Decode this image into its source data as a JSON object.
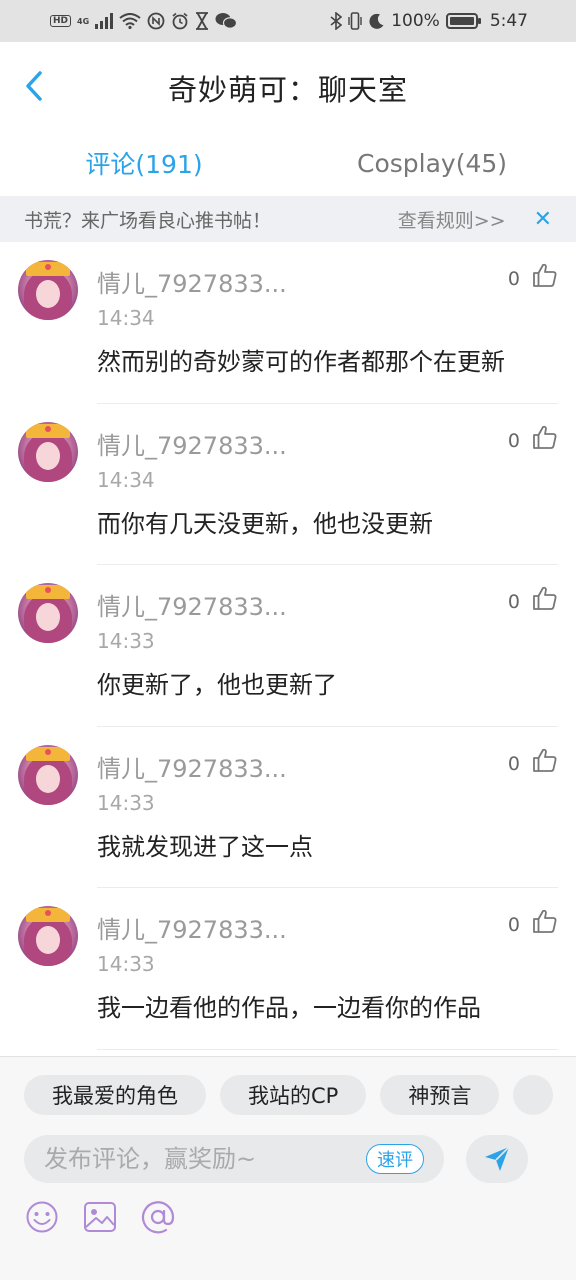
{
  "status_bar": {
    "hd": "HD",
    "signal_label": "4G",
    "battery_percent": "100%",
    "battery_level": 1.0,
    "time": "5:47"
  },
  "header": {
    "title": "奇妙萌可：聊天室"
  },
  "tabs": [
    {
      "label": "评论(191)",
      "active": true
    },
    {
      "label": "Cosplay(45)",
      "active": false
    }
  ],
  "notice": {
    "text": "书荒？来广场看良心推书帖！",
    "link": "查看规则>>",
    "close": "✕"
  },
  "comments": [
    {
      "username": "情儿_7927833...",
      "time": "14:34",
      "content": "然而别的奇妙蒙可的作者都那个在更新",
      "likes": "0"
    },
    {
      "username": "情儿_7927833...",
      "time": "14:34",
      "content": "而你有几天没更新，他也没更新",
      "likes": "0"
    },
    {
      "username": "情儿_7927833...",
      "time": "14:33",
      "content": "你更新了，他也更新了",
      "likes": "0"
    },
    {
      "username": "情儿_7927833...",
      "time": "14:33",
      "content": "我就发现进了这一点",
      "likes": "0"
    },
    {
      "username": "情儿_7927833...",
      "time": "14:33",
      "content": "我一边看他的作品，一边看你的作品",
      "likes": "0"
    }
  ],
  "bottom": {
    "chips": [
      "我最爱的角色",
      "我站的CP",
      "神预言"
    ],
    "input_placeholder": "发布评论，赢奖励~",
    "quick_review": "速评"
  },
  "colors": {
    "accent": "#2aa3e8",
    "tool_purple": "#b08ad6"
  }
}
